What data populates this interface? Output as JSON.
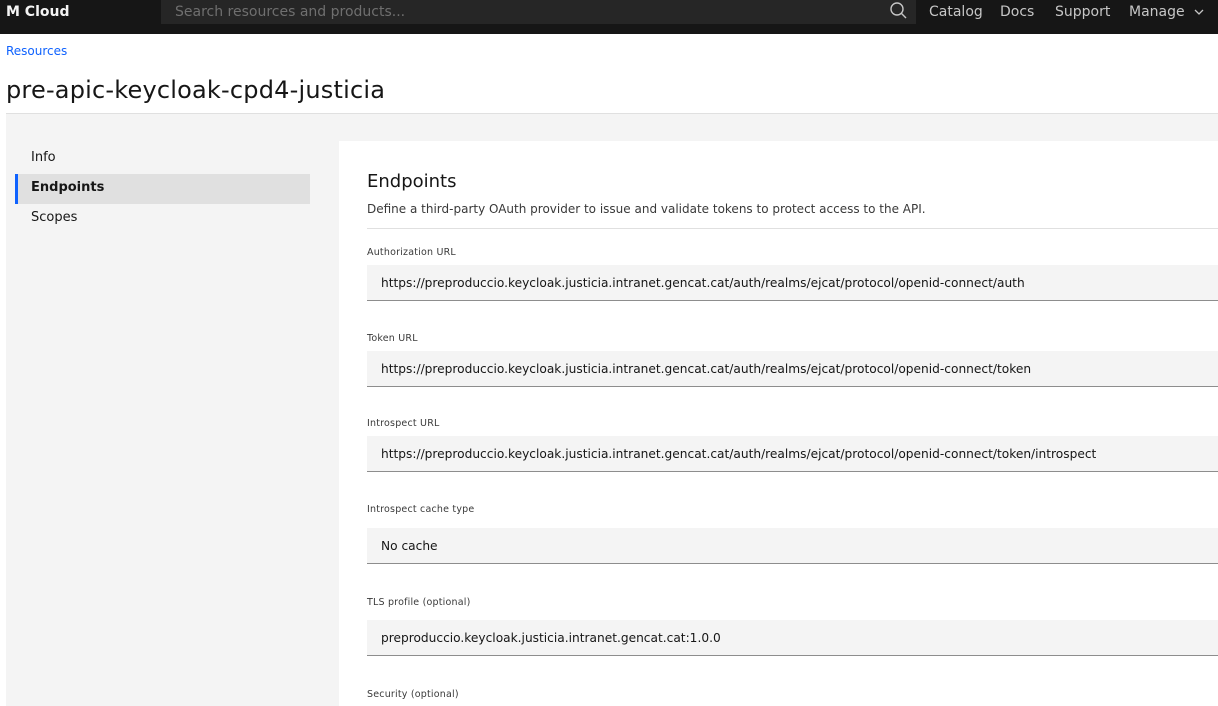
{
  "topbar": {
    "brand": "M Cloud",
    "search_placeholder": "Search resources and products...",
    "nav": [
      {
        "label": "Catalog"
      },
      {
        "label": "Docs"
      },
      {
        "label": "Support"
      },
      {
        "label": "Manage"
      }
    ]
  },
  "breadcrumb": "Resources",
  "page_title": "pre-apic-keycloak-cpd4-justicia",
  "sidebar": {
    "items": [
      {
        "label": "Info",
        "active": false
      },
      {
        "label": "Endpoints",
        "active": true
      },
      {
        "label": "Scopes",
        "active": false
      }
    ]
  },
  "panel": {
    "title": "Endpoints",
    "description": "Define a third-party OAuth provider to issue and validate tokens to protect access to the API.",
    "fields": [
      {
        "label": "Authorization URL",
        "value": "https://preproduccio.keycloak.justicia.intranet.gencat.cat/auth/realms/ejcat/protocol/openid-connect/auth"
      },
      {
        "label": "Token URL",
        "value": "https://preproduccio.keycloak.justicia.intranet.gencat.cat/auth/realms/ejcat/protocol/openid-connect/token"
      },
      {
        "label": "Introspect URL",
        "value": "https://preproduccio.keycloak.justicia.intranet.gencat.cat/auth/realms/ejcat/protocol/openid-connect/token/introspect"
      },
      {
        "label": "Introspect cache type",
        "value": "No cache"
      },
      {
        "label": "TLS profile (optional)",
        "value": "preproduccio.keycloak.justicia.intranet.gencat.cat:1.0.0"
      },
      {
        "label": "Security (optional)"
      }
    ]
  },
  "colors": {
    "topbar_bg": "#161616",
    "accent": "#0f62fe",
    "page_bg": "#f4f4f4"
  },
  "icons": {
    "search": "search-icon",
    "manage_dropdown": "chevron-down-icon"
  }
}
